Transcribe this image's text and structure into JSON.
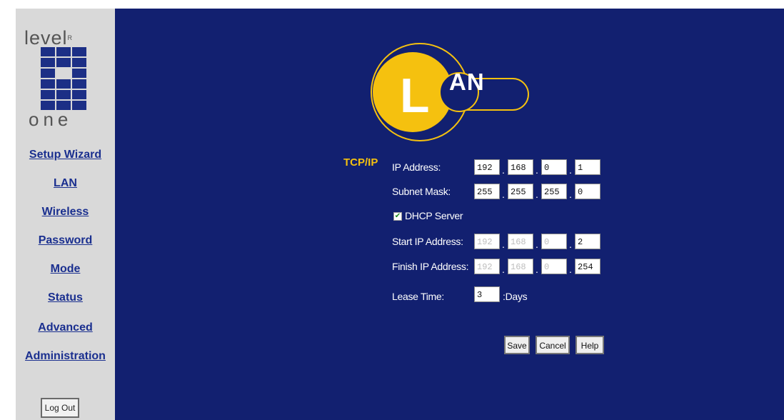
{
  "logo": {
    "top": "level",
    "mark": "R",
    "bottom": "one"
  },
  "nav": {
    "items": [
      {
        "label": "Setup Wizard"
      },
      {
        "label": "LAN"
      },
      {
        "label": "Wireless"
      },
      {
        "label": "Password"
      },
      {
        "label": "Mode"
      },
      {
        "label": "Status"
      },
      {
        "label": "Advanced"
      },
      {
        "label": "Administration"
      }
    ],
    "logout": "Log Out"
  },
  "header": {
    "title_letter": "L",
    "title_rest": "AN"
  },
  "form": {
    "section": "TCP/IP",
    "ip_address": {
      "label": "IP Address:",
      "octets": [
        "192",
        "168",
        "0",
        "1"
      ]
    },
    "subnet_mask": {
      "label": "Subnet Mask:",
      "octets": [
        "255",
        "255",
        "255",
        "0"
      ]
    },
    "dhcp": {
      "label": "DHCP Server",
      "checked": true
    },
    "start_ip": {
      "label": "Start IP Address:",
      "octets": [
        "192",
        "168",
        "0",
        "2"
      ]
    },
    "finish_ip": {
      "label": "Finish IP Address:",
      "octets": [
        "192",
        "168",
        "0",
        "254"
      ]
    },
    "lease": {
      "label": "Lease Time:",
      "value": "3",
      "unit": ":Days"
    }
  },
  "buttons": {
    "save": "Save",
    "cancel": "Cancel",
    "help": "Help"
  },
  "colors": {
    "main_bg": "#122070",
    "sidebar_bg": "#d9d9d9",
    "accent_yellow": "#f5c10f",
    "nav_link": "#1a2f8f"
  }
}
